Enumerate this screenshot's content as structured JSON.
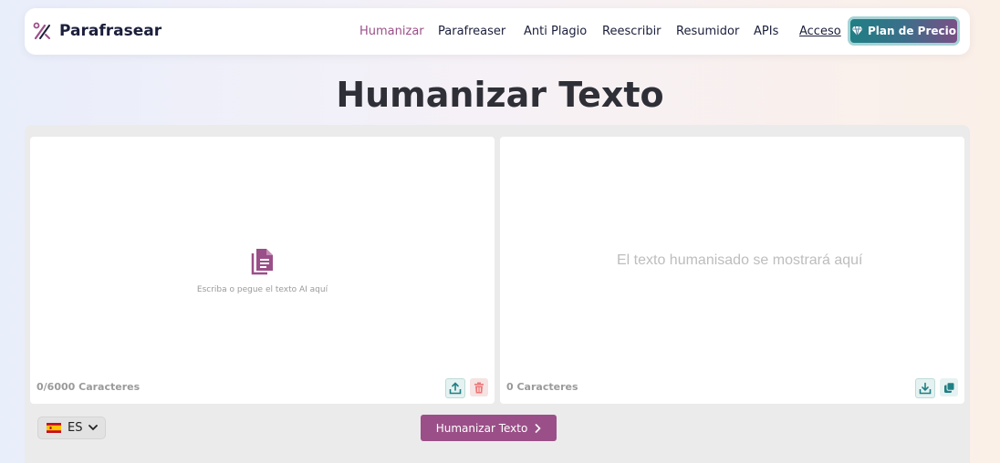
{
  "brand": {
    "name": "Parafrasear"
  },
  "nav": {
    "items": [
      {
        "label": "Humanizar",
        "active": true
      },
      {
        "label": "Parafreaser"
      },
      {
        "label": "Anti Plagio"
      },
      {
        "label": "Reescribir"
      },
      {
        "label": "Resumidor"
      },
      {
        "label": "APIs"
      }
    ],
    "login_label": "Acceso",
    "pricing_label": "Plan de Precio"
  },
  "page": {
    "title": "Humanizar Texto"
  },
  "input_panel": {
    "hint": "Escriba o pegue el texto AI aquí",
    "char_count": "0/6000 Caracteres",
    "upload_icon": "upload-icon",
    "delete_icon": "trash-icon"
  },
  "output_panel": {
    "placeholder": "El texto humanisado se mostrará aquí",
    "char_count": "0 Caracteres",
    "download_icon": "download-icon",
    "copy_icon": "copy-icon"
  },
  "footer": {
    "language_code": "ES",
    "action_label": "Humanizar Texto"
  },
  "colors": {
    "accent": "#9b4f88",
    "teal": "#1f7f84",
    "text_dark": "#2f2f37"
  }
}
